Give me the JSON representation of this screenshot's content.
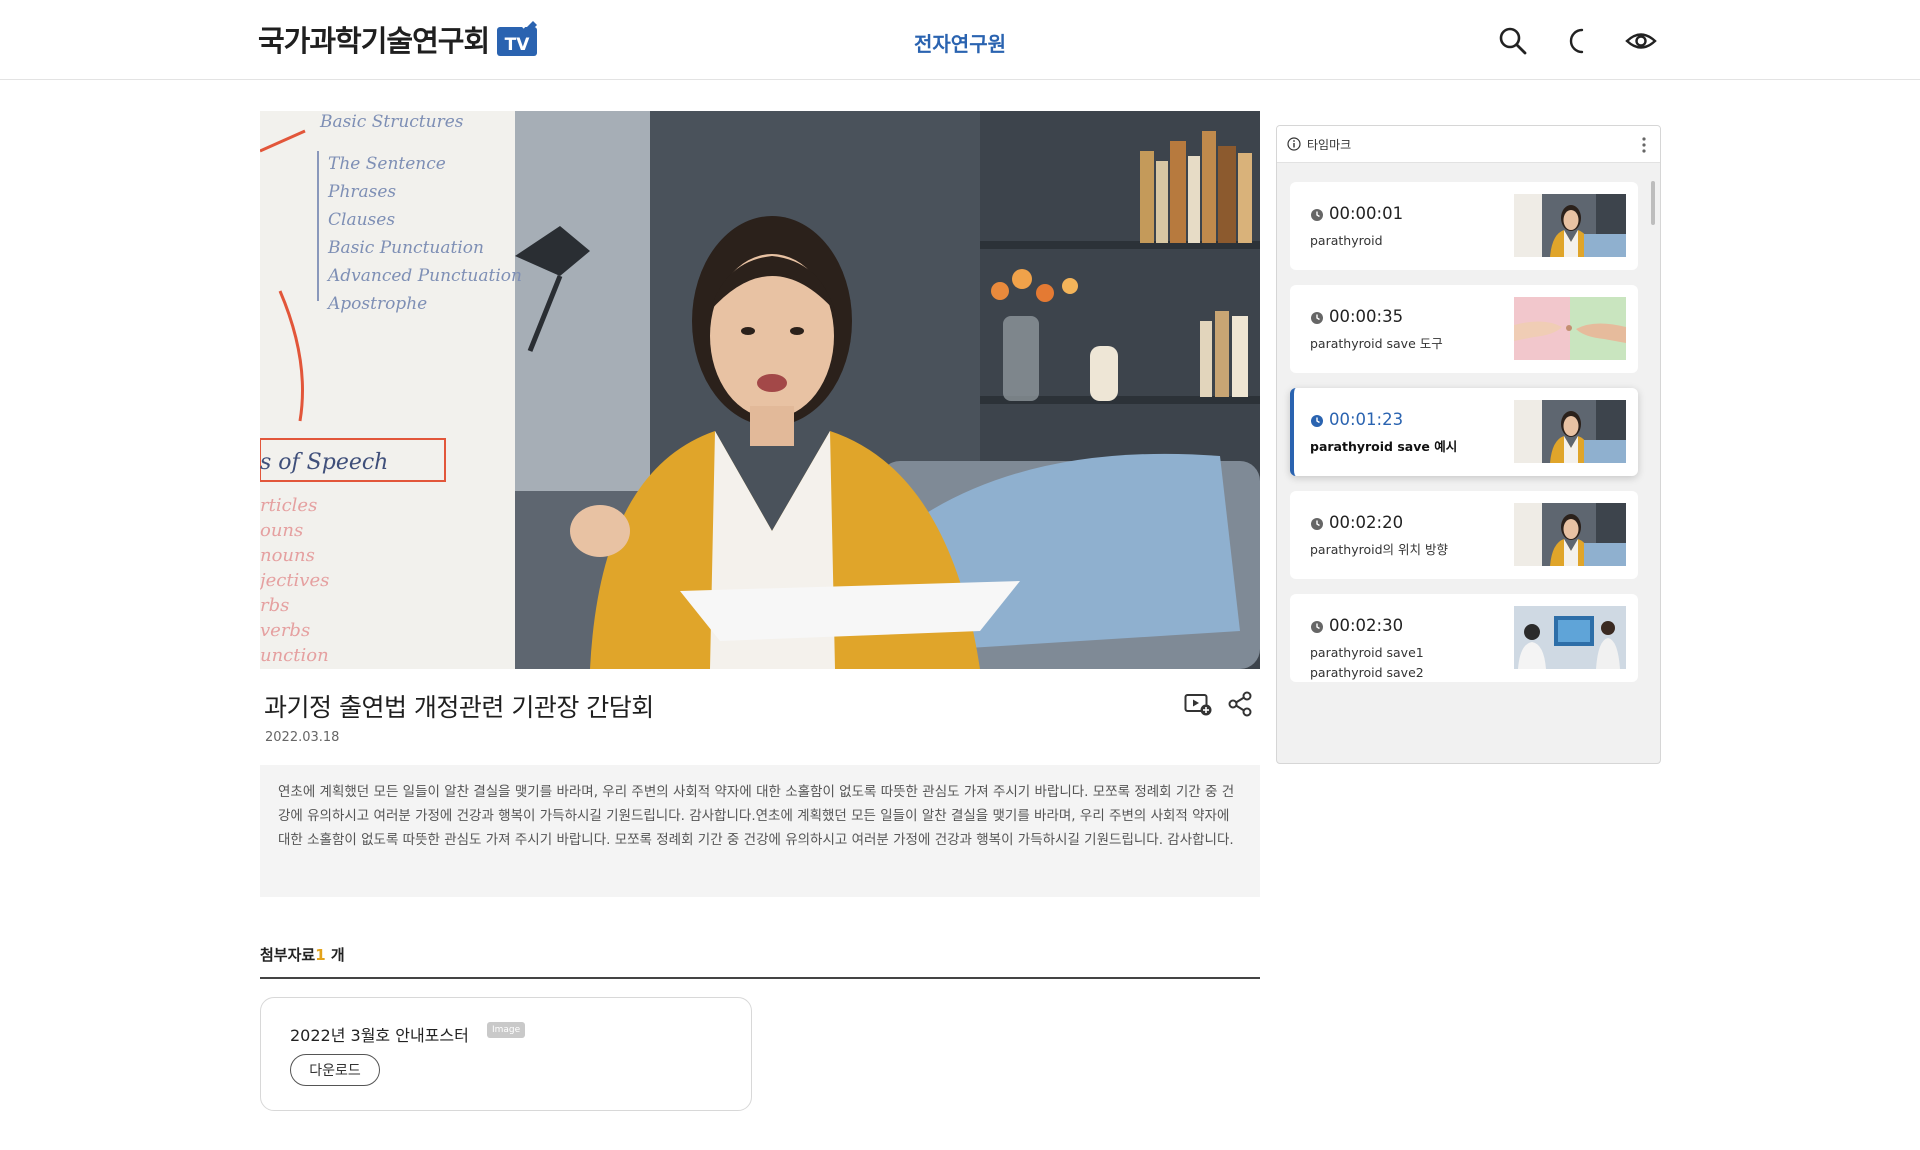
{
  "header": {
    "logo_text": "국가과학기술연구회",
    "logo_badge": "TV",
    "nav_center": "전자연구원",
    "icons": [
      "search-icon",
      "moon-icon",
      "eye-icon"
    ]
  },
  "video": {
    "board_lines": [
      "Basic Structures",
      "The Sentence",
      "Phrases",
      "Clauses",
      "Basic Punctuation",
      "Advanced Punctuation",
      "Apostrophe"
    ],
    "board_lines2": [
      "s of Speech",
      "rticles",
      "ouns",
      "nouns",
      "jectives",
      "rbs",
      "verbs",
      "unction"
    ]
  },
  "content": {
    "title": "과기정 출연법 개정관련 기관장 간담회",
    "date": "2022.03.18",
    "description": "연초에 계획했던 모든 일들이 알찬 결실을 맺기를 바라며, 우리 주변의 사회적 약자에 대한 소홀함이 없도록 따뜻한 관심도 가져 주시기 바랍니다. 모쪼록 정례회 기간 중 건강에 유의하시고 여러분 가정에 건강과 행복이 가득하시길 기원드립니다. 감사합니다.연초에 계획했던 모든 일들이 알찬 결실을 맺기를 바라며, 우리 주변의 사회적 약자에 대한 소홀함이 없도록 따뜻한 관심도 가져 주시기 바랍니다. 모쪼록 정례회 기간 중 건강에 유의하시고 여러분 가정에 건강과 행복이 가득하시길 기원드립니다. 감사합니다."
  },
  "attachments": {
    "label": "첨부자료",
    "count": "1",
    "unit": " 개",
    "items": [
      {
        "name": "2022년 3월호 안내포스터",
        "badge": "Image",
        "download_label": "다운로드"
      }
    ]
  },
  "timemarks": {
    "title": "타임마크",
    "items": [
      {
        "time": "00:00:01",
        "desc": "parathyroid",
        "thumb": "woman",
        "active": false
      },
      {
        "time": "00:00:35",
        "desc": "parathyroid save 도구",
        "thumb": "hands",
        "active": false
      },
      {
        "time": "00:01:23",
        "desc": "parathyroid save 예시",
        "thumb": "woman",
        "active": true
      },
      {
        "time": "00:02:20",
        "desc": "parathyroid의 위치 방향",
        "thumb": "woman",
        "active": false
      },
      {
        "time": "00:02:30",
        "desc": "parathyroid save1\nparathyroid save2",
        "thumb": "lab",
        "active": false
      }
    ]
  },
  "colors": {
    "accent_blue": "#2a63b0",
    "count_orange": "#e3a31b",
    "jacket_yellow": "#e0a52a"
  }
}
